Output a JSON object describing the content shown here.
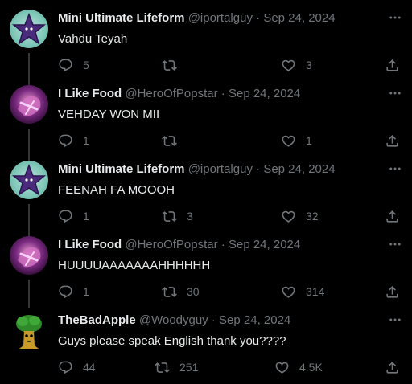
{
  "colors": {
    "background": "#000000",
    "text": "#e7e9ea",
    "muted": "#71767b",
    "thread_line": "#333639"
  },
  "tweets": [
    {
      "name": "Mini Ultimate Lifeform",
      "handle": "@iportalguy",
      "separator": "·",
      "date": "Sep 24, 2024",
      "text": "Vahdu Teyah",
      "replies": "5",
      "retweets": "",
      "likes": "3",
      "avatar": "purple-star-avatar"
    },
    {
      "name": "I Like Food",
      "handle": "@HeroOfPopstar",
      "separator": "·",
      "date": "Sep 24, 2024",
      "text": "VEHDAY WON MII",
      "replies": "1",
      "retweets": "",
      "likes": "1",
      "avatar": "pink-creature-avatar"
    },
    {
      "name": "Mini Ultimate Lifeform",
      "handle": "@iportalguy",
      "separator": "·",
      "date": "Sep 24, 2024",
      "text": "FEENAH FA MOOOH",
      "replies": "1",
      "retweets": "3",
      "likes": "32",
      "avatar": "purple-star-avatar"
    },
    {
      "name": "I Like Food",
      "handle": "@HeroOfPopstar",
      "separator": "·",
      "date": "Sep 24, 2024",
      "text": "HUUUUAAAAAAAHHHHHH",
      "replies": "1",
      "retweets": "30",
      "likes": "314",
      "avatar": "pink-creature-avatar"
    },
    {
      "name": "TheBadApple",
      "handle": "@Woodyguy",
      "separator": "·",
      "date": "Sep 24, 2024",
      "text": "Guys please speak English thank you????",
      "replies": "44",
      "retweets": "251",
      "likes": "4.5K",
      "avatar": "tree-avatar"
    }
  ]
}
